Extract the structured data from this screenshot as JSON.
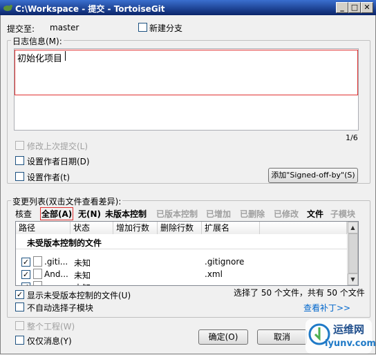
{
  "window": {
    "title": "C:\\Workspace - 提交 - TortoiseGit"
  },
  "commit": {
    "to_label": "提交至:",
    "branch": "master",
    "new_branch_label": "新建分支"
  },
  "log": {
    "group_label": "日志信息(M):",
    "message": "初始化项目",
    "counter": "1/6"
  },
  "options": {
    "amend": "修改上次提交(L)",
    "set_date": "设置作者日期(D)",
    "set_author": "设置作者(t)",
    "signed_off": "添加\"Signed-off-by\"(S)"
  },
  "changes": {
    "group_label": "变更列表(双击文件查看差异):",
    "filter_label": "核查",
    "filters": [
      "全部(A)",
      "无(N)",
      "未版本控制",
      "已版本控制",
      "已增加",
      "已删除",
      "已修改",
      "文件",
      "子模块"
    ],
    "columns": [
      "路径",
      "状态",
      "增加行数",
      "删除行数",
      "扩展名"
    ],
    "section_header": "未受版本控制的文件",
    "rows": [
      {
        "path": ".giti...",
        "status": "未知",
        "ext": ".gitignore"
      },
      {
        "path": "And...",
        "status": "未知",
        "ext": ".xml"
      },
      {
        "path": "...",
        "status": "未知",
        "ext": "..."
      }
    ],
    "show_unversioned": "显示未受版本控制的文件(U)",
    "no_auto_submodule": "不自动选择子模块",
    "selection_summary": "选择了 50 个文件，共有 50 个文件",
    "view_patch": "查看补丁>>"
  },
  "footer": {
    "whole_project": "整个工程(W)",
    "message_only": "仅仅消息(Y)",
    "ok": "确定(O)",
    "cancel": "取消"
  },
  "watermark": {
    "site": "运维网",
    "url": "iyunv.com"
  }
}
